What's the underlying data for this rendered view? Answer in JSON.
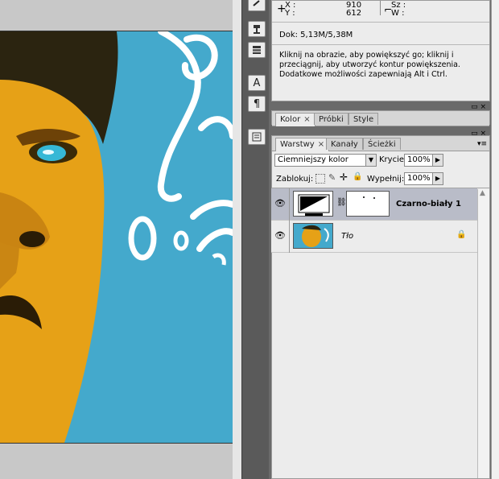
{
  "info_panel": {
    "x_label": "X :",
    "y_label": "Y :",
    "x_value": "910",
    "y_value": "612",
    "w_label": "Sz :",
    "h_label": "W :",
    "doc": "Dok: 5,13M/5,38M",
    "hint": "Kliknij na obrazie, aby powiększyć go; kliknij i przeciągnij, aby utworzyć kontur powiększenia. Dodatkowe możliwości zapewniają  Alt i Ctrl."
  },
  "tools": {
    "type_tool_glyph": "A",
    "paragraph_glyph": "¶"
  },
  "color_panel": {
    "tabs": [
      "Kolor",
      "Próbki",
      "Style"
    ],
    "active_close": "×",
    "ctrl": "▭ ×",
    "menu": "▾≡"
  },
  "layers_panel": {
    "tabs": [
      "Warstwy",
      "Kanały",
      "Ścieżki"
    ],
    "active_close": "×",
    "ctrl": "▭ ×",
    "menu": "▾≡",
    "blend_mode": "Ciemniejszy kolor",
    "opacity_label": "Krycie:",
    "opacity_value": "100%",
    "lock_label": "Zablokuj:",
    "fill_label": "Wypełnij:",
    "fill_value": "100%",
    "layers": [
      {
        "name": "Czarno-biały 1",
        "selected": true
      },
      {
        "name": "Tło",
        "selected": false
      }
    ]
  },
  "colors": {
    "sky": "#44a9cc",
    "skin": "#e6a117",
    "selected_row": "#b9bcc8"
  }
}
